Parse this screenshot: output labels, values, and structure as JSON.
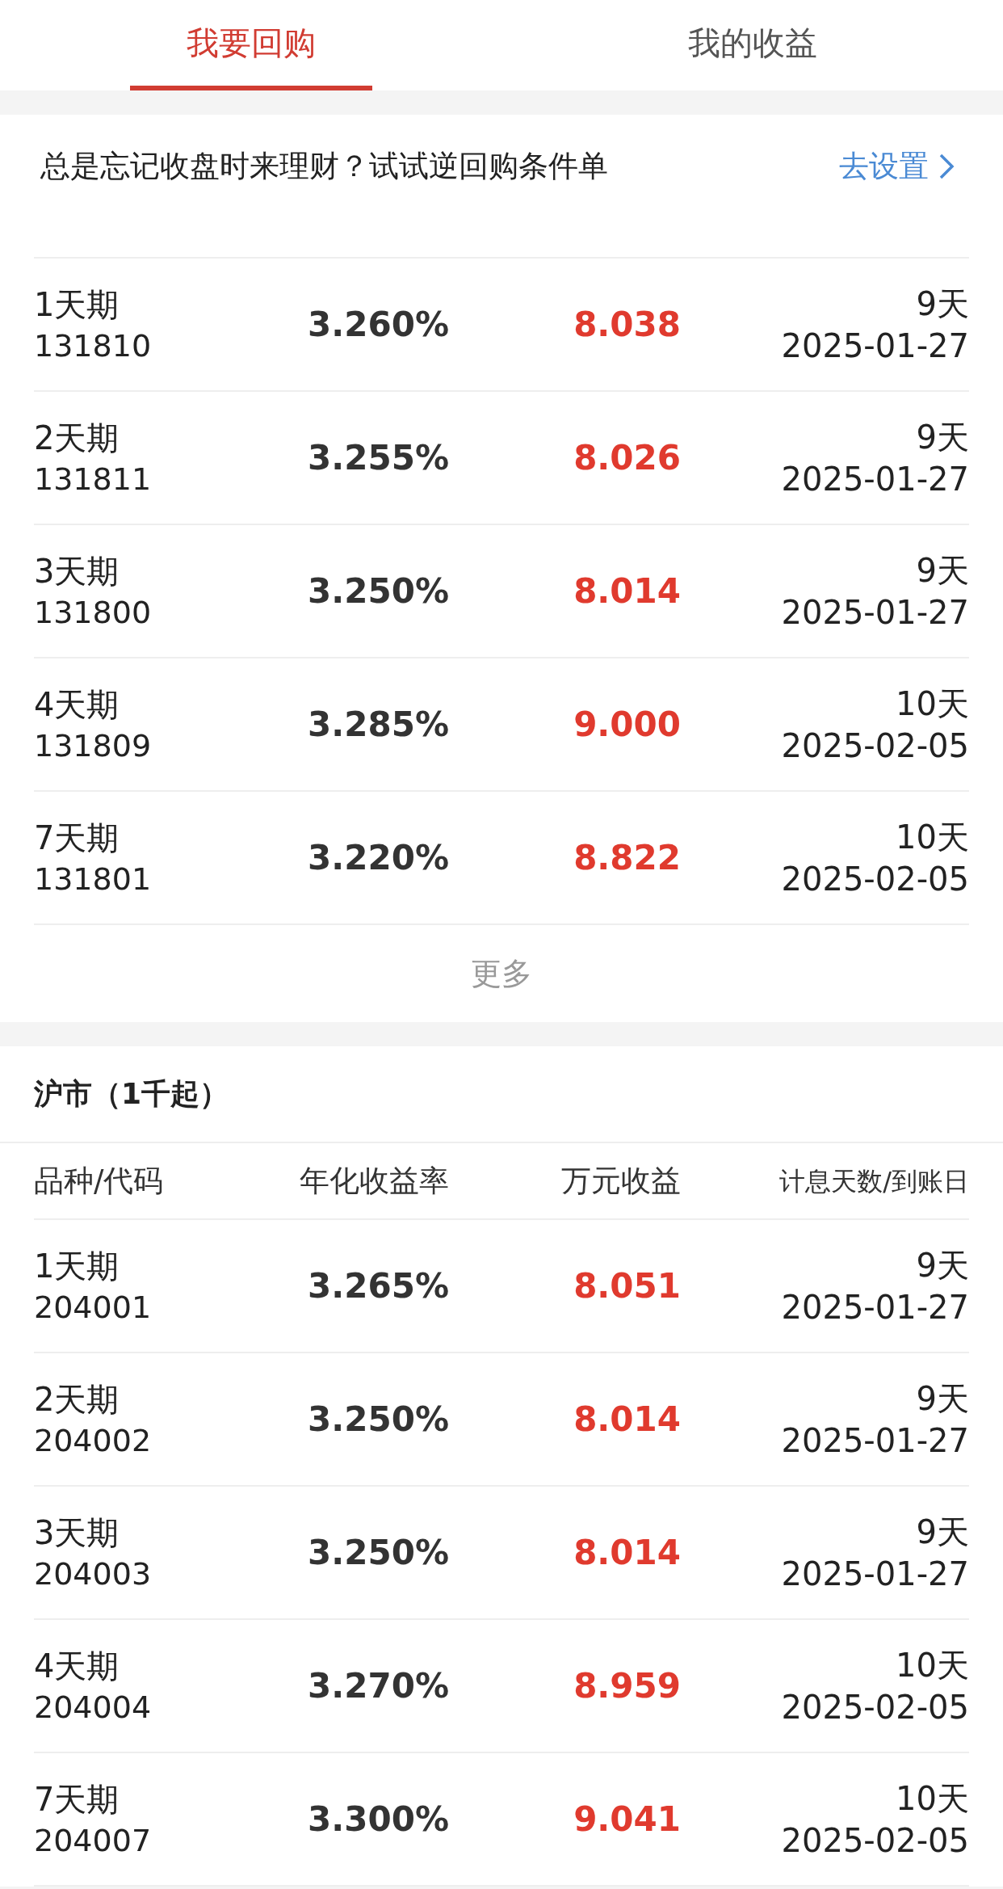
{
  "tabs": [
    {
      "label": "我要回购",
      "selected": true
    },
    {
      "label": "我的收益",
      "selected": false
    }
  ],
  "promo": {
    "text": "总是忘记收盘时来理财？试试逆回购条件单",
    "action": "去设置"
  },
  "tables": [
    {
      "rows": [
        {
          "name": "1天期",
          "code": "131810",
          "rate": "3.260%",
          "yield": "8.038",
          "days": "9天",
          "date": "2025-01-27"
        },
        {
          "name": "2天期",
          "code": "131811",
          "rate": "3.255%",
          "yield": "8.026",
          "days": "9天",
          "date": "2025-01-27"
        },
        {
          "name": "3天期",
          "code": "131800",
          "rate": "3.250%",
          "yield": "8.014",
          "days": "9天",
          "date": "2025-01-27"
        },
        {
          "name": "4天期",
          "code": "131809",
          "rate": "3.285%",
          "yield": "9.000",
          "days": "10天",
          "date": "2025-02-05"
        },
        {
          "name": "7天期",
          "code": "131801",
          "rate": "3.220%",
          "yield": "8.822",
          "days": "10天",
          "date": "2025-02-05"
        }
      ],
      "more": "更多"
    },
    {
      "title": "沪市（1千起）",
      "columns": [
        "品种/代码",
        "年化收益率",
        "万元收益",
        "计息天数/到账日"
      ],
      "rows": [
        {
          "name": "1天期",
          "code": "204001",
          "rate": "3.265%",
          "yield": "8.051",
          "days": "9天",
          "date": "2025-01-27"
        },
        {
          "name": "2天期",
          "code": "204002",
          "rate": "3.250%",
          "yield": "8.014",
          "days": "9天",
          "date": "2025-01-27"
        },
        {
          "name": "3天期",
          "code": "204003",
          "rate": "3.250%",
          "yield": "8.014",
          "days": "9天",
          "date": "2025-01-27"
        },
        {
          "name": "4天期",
          "code": "204004",
          "rate": "3.270%",
          "yield": "8.959",
          "days": "10天",
          "date": "2025-02-05"
        },
        {
          "name": "7天期",
          "code": "204007",
          "rate": "3.300%",
          "yield": "9.041",
          "days": "10天",
          "date": "2025-02-05"
        }
      ]
    }
  ]
}
